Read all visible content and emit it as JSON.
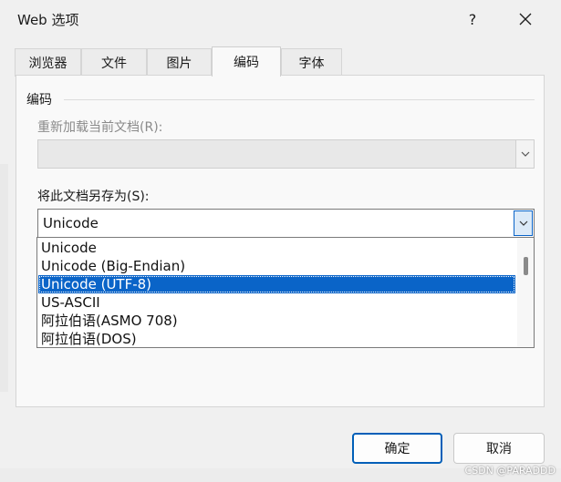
{
  "window": {
    "title": "Web 选项",
    "help_label": "?",
    "watermark": "CSDN @PARADDD"
  },
  "tabs": [
    {
      "label": "浏览器",
      "active": false
    },
    {
      "label": "文件",
      "active": false
    },
    {
      "label": "图片",
      "active": false
    },
    {
      "label": "编码",
      "active": true
    },
    {
      "label": "字体",
      "active": false
    }
  ],
  "encoding": {
    "group_title": "编码",
    "reload_label": "重新加载当前文档(R):",
    "reload_value": "",
    "save_as_label": "将此文档另存为(S):",
    "save_as_value": "Unicode",
    "options": [
      "Unicode",
      "Unicode (Big-Endian)",
      "Unicode (UTF-8)",
      "US-ASCII",
      "阿拉伯语(ASMO 708)",
      "阿拉伯语(DOS)"
    ],
    "selected_index": 2
  },
  "buttons": {
    "ok_label": "确定",
    "cancel_label": "取消"
  },
  "colors": {
    "accent": "#0a64c8",
    "primary_border": "#005fb8"
  }
}
